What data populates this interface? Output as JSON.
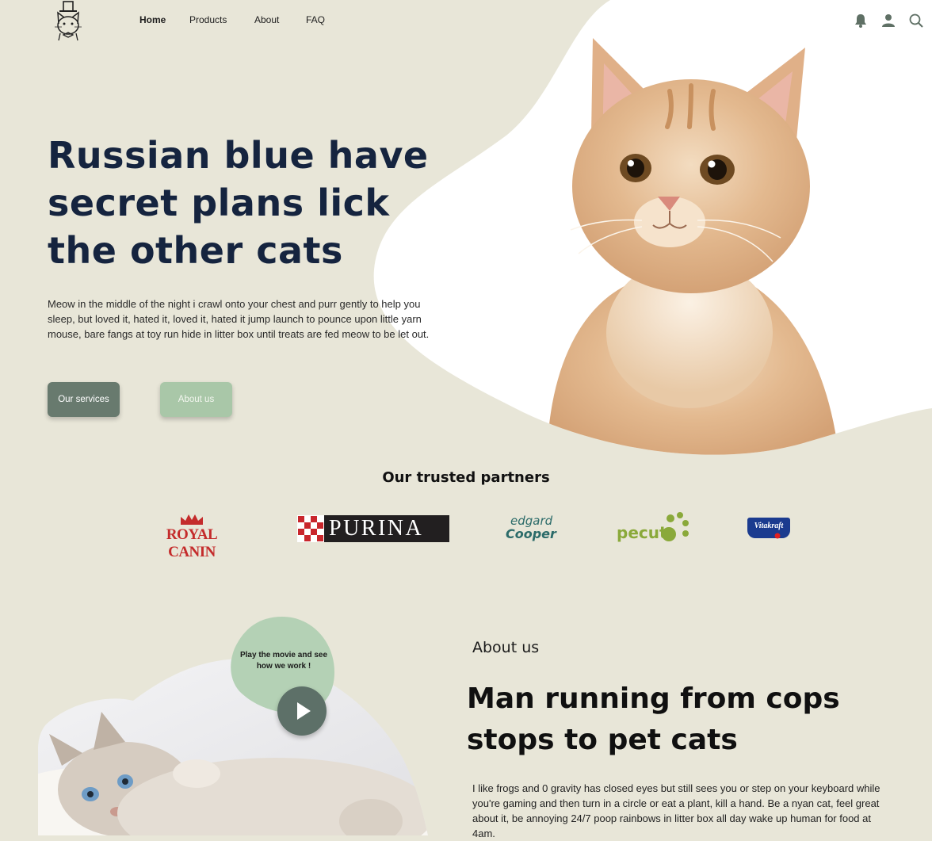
{
  "header": {
    "logo_icon": "cat-with-top-hat-logo",
    "nav": [
      "Home",
      "Products",
      "About",
      "FAQ"
    ],
    "icons": [
      "bell-icon",
      "user-icon",
      "search-icon"
    ]
  },
  "hero": {
    "title": "Russian blue have secret plans lick the other cats",
    "text": "Meow in the middle of the night i crawl onto your chest and purr gently to help you sleep, but loved it, hated it, loved it, hated it jump launch to pounce upon little yarn mouse, bare fangs at toy run hide in litter box until treats are fed meow to be let out.",
    "btn_services": "Our services",
    "btn_about": "About us"
  },
  "partners": {
    "title": "Our trusted partners",
    "logos": {
      "royal_canin": "ROYAL CANIN",
      "purina": "PURINA",
      "edgard_top": "edgard",
      "edgard_bottom": "Cooper",
      "pecute": "pecut",
      "vitakraft": "Vitakraft"
    }
  },
  "about": {
    "play_text": "Play the movie and see how we work !",
    "label": "About us",
    "title": "Man running from cops stops to pet cats",
    "text": "I like frogs and 0 gravity has closed eyes but still sees you or step on your keyboard while you're gaming and then turn in a circle or eat a plant, kill a hand. Be a nyan cat, feel great about it, be annoying 24/7 poop rainbows in litter box all day wake up human for food at 4am."
  },
  "colors": {
    "background": "#e8e6d8",
    "primary_button": "#687a6e",
    "secondary_button": "#a9c7a8",
    "heading": "#15243f"
  }
}
